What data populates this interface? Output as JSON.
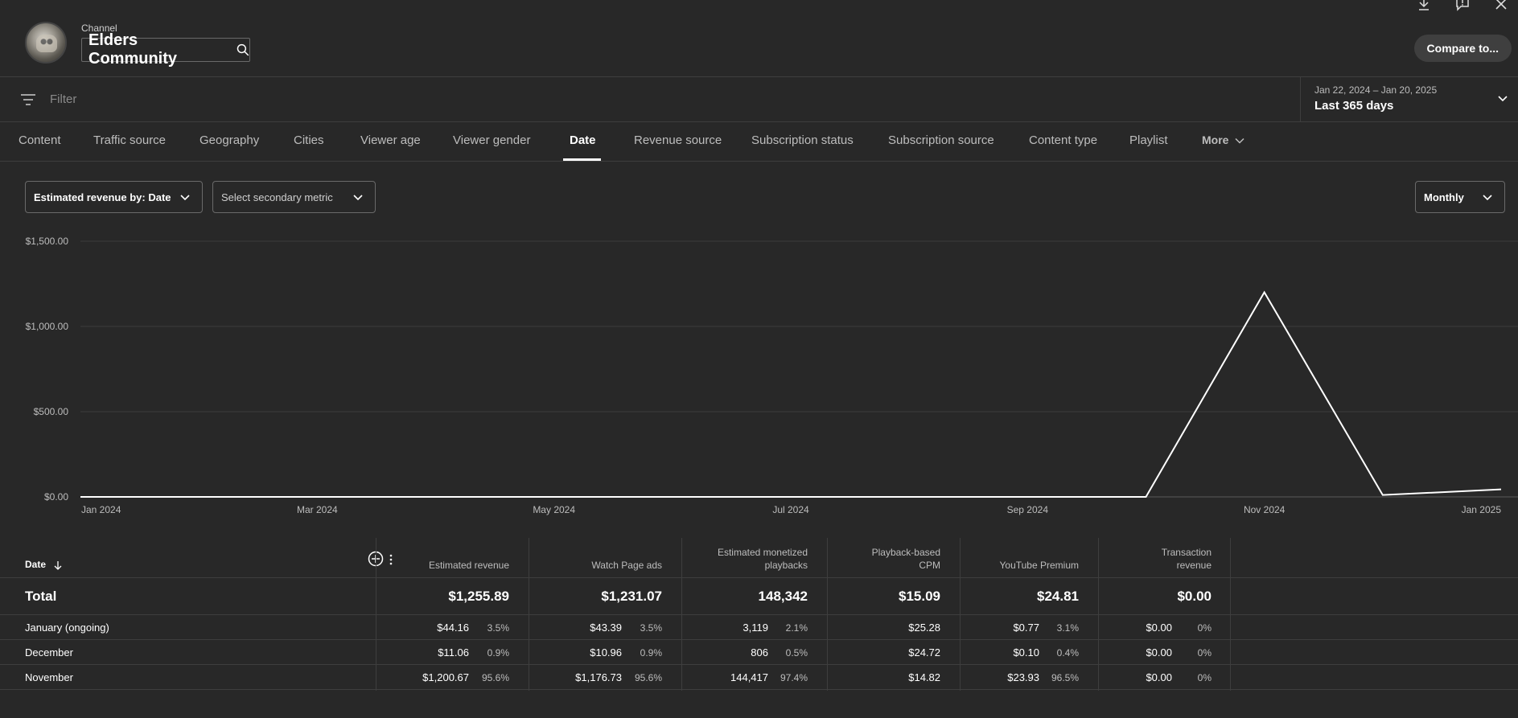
{
  "header": {
    "channel_label": "Channel",
    "channel_name": "Elders Community",
    "compare_label": "Compare to...",
    "icons": [
      "download-icon",
      "feedback-icon",
      "close-icon"
    ]
  },
  "filter": {
    "placeholder": "Filter"
  },
  "date_range": {
    "range": "Jan 22, 2024 – Jan 20, 2025",
    "label": "Last 365 days"
  },
  "tabs": [
    {
      "label": "Content"
    },
    {
      "label": "Traffic source"
    },
    {
      "label": "Geography"
    },
    {
      "label": "Cities"
    },
    {
      "label": "Viewer age"
    },
    {
      "label": "Viewer gender"
    },
    {
      "label": "Date",
      "active": true
    },
    {
      "label": "Revenue source"
    },
    {
      "label": "Subscription status"
    },
    {
      "label": "Subscription source"
    },
    {
      "label": "Content type"
    },
    {
      "label": "Playlist"
    },
    {
      "label": "More"
    }
  ],
  "controls": {
    "primary_metric": "Estimated revenue by: Date",
    "secondary_metric": "Select secondary metric",
    "granularity": "Monthly"
  },
  "chart_data": {
    "type": "line",
    "x_tick_labels": [
      "Jan 2024",
      "Mar 2024",
      "May 2024",
      "Jul 2024",
      "Sep 2024",
      "Nov 2024",
      "Jan 2025"
    ],
    "y_tick_labels": [
      "$0.00",
      "$500.00",
      "$1,000.00",
      "$1,500.00"
    ],
    "ylim": [
      0,
      1500
    ],
    "grid": true,
    "series": [
      {
        "x": [
          "Jan 2024",
          "Feb 2024",
          "Mar 2024",
          "Apr 2024",
          "May 2024",
          "Jun 2024",
          "Jul 2024",
          "Aug 2024",
          "Sep 2024",
          "Oct 2024",
          "Nov 2024",
          "Dec 2024",
          "Jan 2025"
        ],
        "values": [
          0,
          0,
          0,
          0,
          0,
          0,
          0,
          0,
          0,
          0,
          1200.67,
          11.06,
          44.16
        ]
      }
    ]
  },
  "table": {
    "date_header": "Date",
    "columns": [
      {
        "line1": "",
        "line2": "Estimated revenue"
      },
      {
        "line1": "",
        "line2": "Watch Page ads"
      },
      {
        "line1": "Estimated monetized",
        "line2": "playbacks"
      },
      {
        "line1": "Playback-based",
        "line2": "CPM"
      },
      {
        "line1": "",
        "line2": "YouTube Premium"
      },
      {
        "line1": "Transaction",
        "line2": "revenue"
      }
    ],
    "total": {
      "label": "Total",
      "values": [
        "$1,255.89",
        "$1,231.07",
        "148,342",
        "$15.09",
        "$24.81",
        "$0.00"
      ]
    },
    "rows": [
      {
        "label": "January (ongoing)",
        "cells": [
          [
            "$44.16",
            "3.5%"
          ],
          [
            "$43.39",
            "3.5%"
          ],
          [
            "3,119",
            "2.1%"
          ],
          [
            "$25.28",
            ""
          ],
          [
            "$0.77",
            "3.1%"
          ],
          [
            "$0.00",
            "0%"
          ]
        ]
      },
      {
        "label": "December",
        "cells": [
          [
            "$11.06",
            "0.9%"
          ],
          [
            "$10.96",
            "0.9%"
          ],
          [
            "806",
            "0.5%"
          ],
          [
            "$24.72",
            ""
          ],
          [
            "$0.10",
            "0.4%"
          ],
          [
            "$0.00",
            "0%"
          ]
        ]
      },
      {
        "label": "November",
        "cells": [
          [
            "$1,200.67",
            "95.6%"
          ],
          [
            "$1,176.73",
            "95.6%"
          ],
          [
            "144,417",
            "97.4%"
          ],
          [
            "$14.82",
            ""
          ],
          [
            "$23.93",
            "96.5%"
          ],
          [
            "$0.00",
            "0%"
          ]
        ]
      }
    ]
  }
}
